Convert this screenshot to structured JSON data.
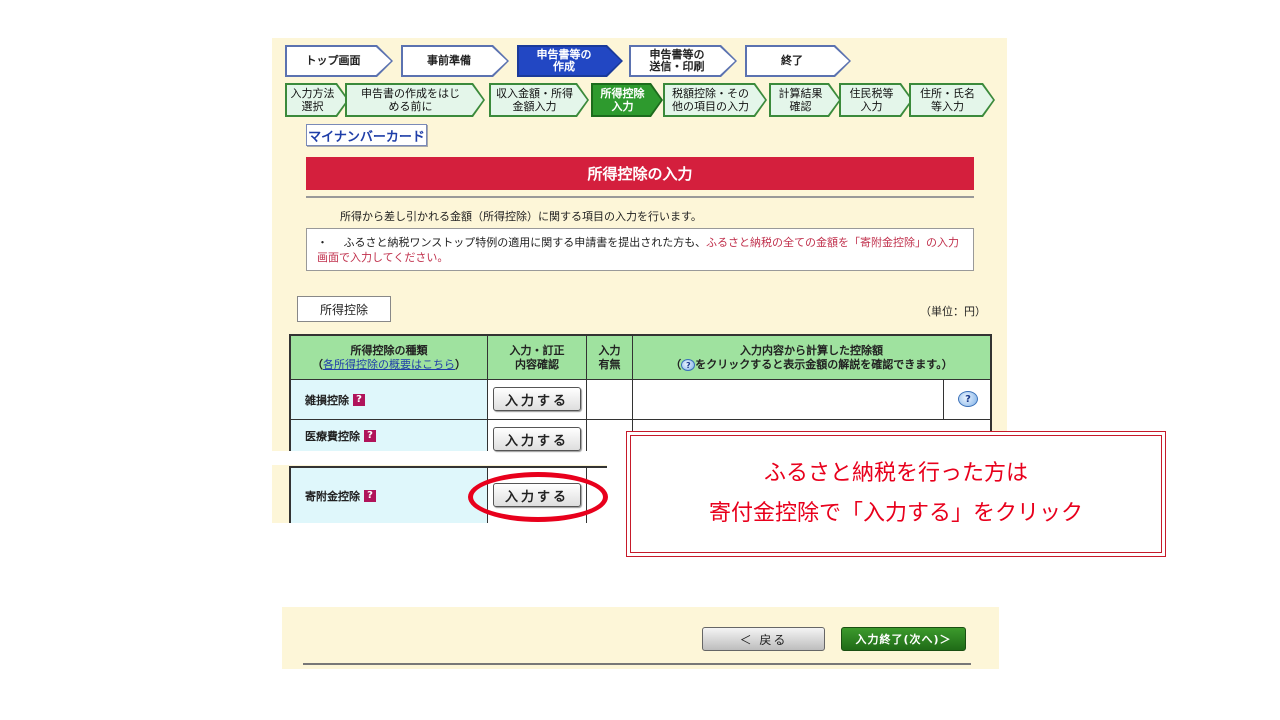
{
  "steps_top": [
    {
      "label": "トップ画面"
    },
    {
      "label": "事前準備"
    },
    {
      "label": "申告書等の\n作成",
      "active": true
    },
    {
      "label": "申告書等の\n送信・印刷"
    },
    {
      "label": "終了"
    }
  ],
  "steps_sub": [
    {
      "label": "入力方法\n選択"
    },
    {
      "label": "申告書の作成をはじ\nめる前に"
    },
    {
      "label": "収入金額・所得\n金額入力"
    },
    {
      "label": "所得控除\n入力",
      "active": true
    },
    {
      "label": "税額控除・その\n他の項目の入力"
    },
    {
      "label": "計算結果\n確認"
    },
    {
      "label": "住民税等\n入力"
    },
    {
      "label": "住所・氏名\n等入力"
    }
  ],
  "mynumber_label": "マイナンバーカード",
  "page_title": "所得控除の入力",
  "description": "所得から差し引かれる金額（所得控除）に関する項目の入力を行います。",
  "notice": {
    "bullet": "・",
    "text_black": "ふるさと納税ワンストップ特例の適用に関する申請書を提出された方も、",
    "text_red": "ふるさと納税の全ての金額を「寄附金控除」の入力画面で入力してください。"
  },
  "section_button": "所得控除",
  "unit_label": "（単位：円）",
  "table": {
    "headers": {
      "type_title": "所得控除の種類",
      "type_link": "各所得控除の概要はこちら",
      "confirm": "入力・訂正\n内容確認",
      "has_input": "入力\n有無",
      "amount_title": "入力内容から計算した控除額",
      "amount_note": "をクリックすると表示金額の解説を確認できます。"
    },
    "rows": [
      {
        "label": "雑損控除",
        "button": "入力する"
      },
      {
        "label": "医療費控除",
        "button": "入力する"
      },
      {
        "label": "寄附金控除",
        "button": "入力する"
      }
    ]
  },
  "callout": {
    "line1": "ふるさと納税を行った方は",
    "line2": "寄付金控除で「入力する」をクリック"
  },
  "nav": {
    "back": "＜ 戻る",
    "next": "入力終了(次へ)＞"
  },
  "colors": {
    "title_red": "#d41f3d",
    "header_green": "#9fe29f",
    "callout_red": "#e8001c"
  },
  "icons": {
    "help": "question-bubble-icon",
    "info": "question-square-icon"
  }
}
